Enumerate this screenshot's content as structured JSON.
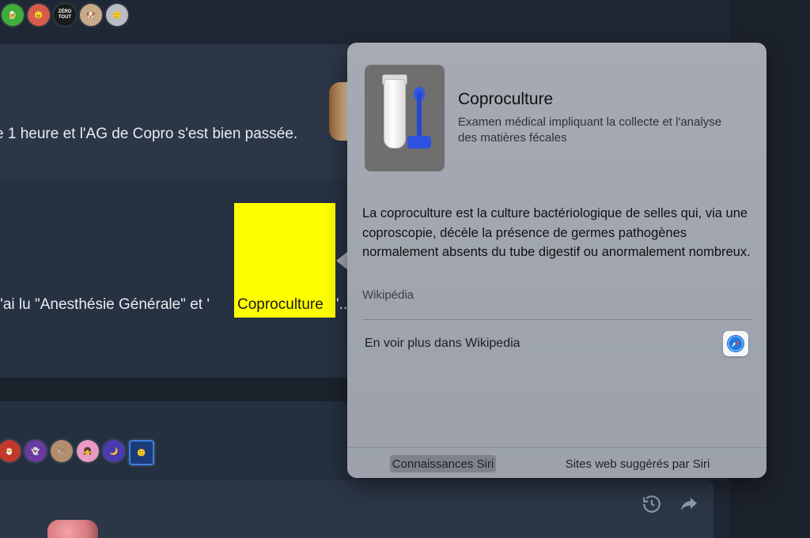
{
  "background": {
    "top_avatars": [
      "green-beer-badge",
      "red-face-badge",
      "zero-tout-badge",
      "dog-badge",
      "gray-face-badge"
    ],
    "bottom_avatars": [
      "red-santa-badge",
      "purple-ghost-badge",
      "sloth-badge",
      "pink-girl-badge",
      "purple-moon-badge",
      "smiley-badge"
    ]
  },
  "badges": {
    "zero_tout": "ZÉRO TOUT"
  },
  "messages": {
    "msg1": "e 1 heure et l'AG de Copro s'est bien passée.",
    "msg2_before": "j'ai lu \"Anesthésie Générale\" et '",
    "msg2_highlight": "Coproculture",
    "msg2_after": "'.."
  },
  "popover": {
    "title": "Coproculture",
    "subtitle": "Examen médical impliquant la collecte et l'analyse des matières fécales",
    "body": "La coproculture est la culture bactériologique de selles qui, via une coproscopie, décèle la présence de germes pathogènes normalement absents du tube digestif ou anormalement nombreux.",
    "source": "Wikipédia",
    "more_link": "En voir plus dans Wikipedia",
    "tabs": [
      "Connaissances Siri",
      "Sites web suggérés par Siri"
    ],
    "active_tab": "Connaissances Siri"
  },
  "colors": {
    "highlight": "#ffff00",
    "safari_blue": "#1f7ae0"
  }
}
